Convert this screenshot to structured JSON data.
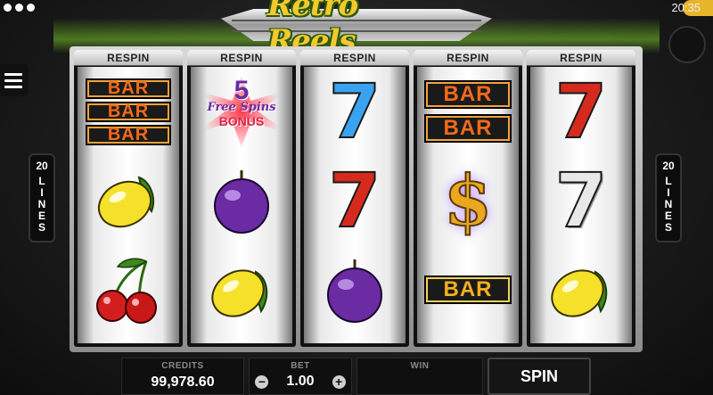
{
  "status": {
    "time": "20:35"
  },
  "header": {
    "logo": "Retro Reels"
  },
  "side": {
    "lines_number": "20",
    "lines_letters": [
      "L",
      "I",
      "N",
      "E",
      "S"
    ]
  },
  "reels": [
    {
      "respin_label": "RESPIN",
      "symbols": [
        "bar-triple",
        "lemon",
        "cherry"
      ]
    },
    {
      "respin_label": "RESPIN",
      "symbols": [
        "bonus",
        "plum",
        "lemon"
      ]
    },
    {
      "respin_label": "RESPIN",
      "symbols": [
        "seven-blue",
        "seven-red",
        "plum"
      ]
    },
    {
      "respin_label": "RESPIN",
      "symbols": [
        "bar-double",
        "dollar",
        "bar-single"
      ]
    },
    {
      "respin_label": "RESPIN",
      "symbols": [
        "seven-red",
        "seven-silver",
        "lemon"
      ]
    }
  ],
  "symbol_text": {
    "bar": "BAR",
    "seven": "7",
    "dollar": "$",
    "bonus_number": "5",
    "bonus_line1": "Free Spins",
    "bonus_line2": "BONUS"
  },
  "bottom": {
    "credits_label": "CREDITS",
    "credits_value": "99,978.60",
    "bet_label": "BET",
    "bet_value": "1.00",
    "bet_minus": "−",
    "bet_plus": "+",
    "win_label": "WIN",
    "win_value": "",
    "spin_label": "SPIN"
  },
  "colors": {
    "accent": "#f3c92d",
    "bar_orange": "#f26a1b",
    "seven_red": "#d72a1e",
    "seven_blue": "#3aa3f0",
    "plum": "#6a2ba3"
  }
}
